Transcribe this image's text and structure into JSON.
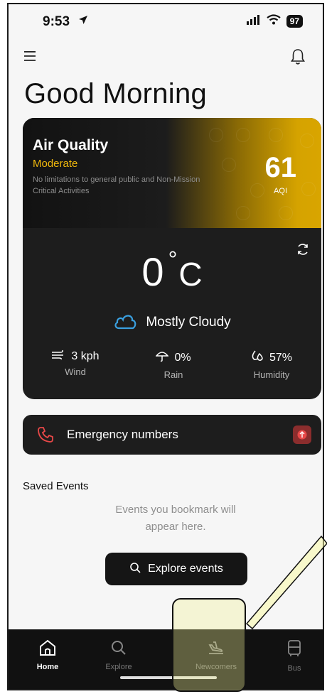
{
  "status_bar": {
    "time": "9:53",
    "battery": "97"
  },
  "header": {
    "greeting": "Good Morning"
  },
  "air_quality": {
    "title": "Air Quality",
    "status": "Moderate",
    "description": "No limitations to general public and Non-Mission Critical Activities",
    "aqi_value": "61",
    "aqi_label": "AQI"
  },
  "weather": {
    "temperature": "0",
    "degree_symbol": "°",
    "unit": "C",
    "condition": "Mostly Cloudy",
    "stats": [
      {
        "value": "3 kph",
        "label": "Wind",
        "icon": "wind-icon"
      },
      {
        "value": "0%",
        "label": "Rain",
        "icon": "umbrella-icon"
      },
      {
        "value": "57%",
        "label": "Humidity",
        "icon": "humidity-icon"
      }
    ]
  },
  "emergency": {
    "label": "Emergency numbers"
  },
  "saved_events": {
    "title": "Saved Events",
    "empty_message": "Events you bookmark will appear here.",
    "explore_button": "Explore events"
  },
  "bottom_nav": [
    {
      "label": "Home",
      "icon": "home-icon",
      "active": true
    },
    {
      "label": "Explore",
      "icon": "search-icon",
      "active": false
    },
    {
      "label": "Newcomers",
      "icon": "plane-landing-icon",
      "active": false
    },
    {
      "label": "Bus",
      "icon": "bus-icon",
      "active": false
    }
  ],
  "colors": {
    "accent_yellow": "#f0b80c",
    "card_background": "#1d1d1d",
    "weather_icon_blue": "#3aa0e0",
    "emergency_red": "#e74848"
  }
}
